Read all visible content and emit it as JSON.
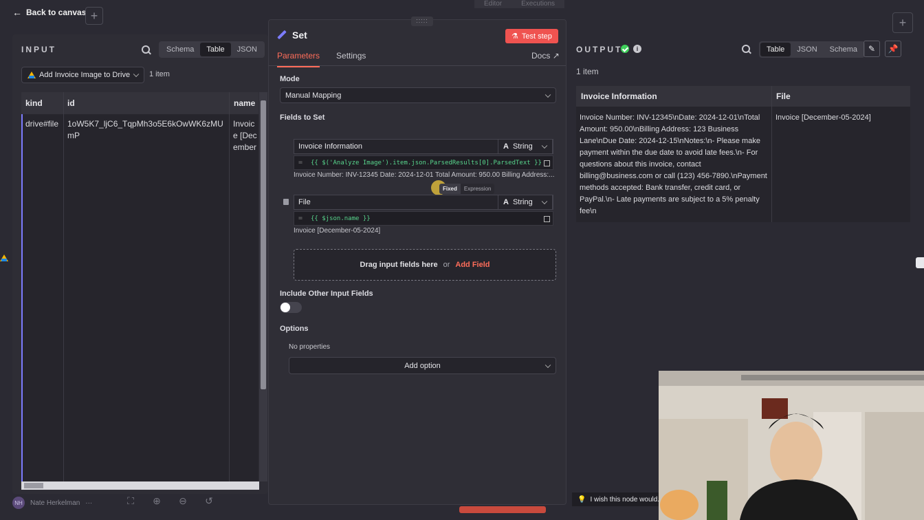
{
  "topbar": {
    "back_label": "Back to canvas",
    "tabs": [
      "Editor",
      "Executions"
    ]
  },
  "input": {
    "title": "INPUT",
    "view_modes": [
      "Schema",
      "Table",
      "JSON"
    ],
    "active_view": "Table",
    "node_select": "Add Invoice Image to Drive",
    "items_count": "1 item",
    "columns": [
      "kind",
      "id",
      "name"
    ],
    "row": {
      "kind": "drive#file",
      "id": "1oW5K7_ljC6_TqpMh3o5E6kOwWK6zMUmP",
      "name": "Invoice [December-05-2024]"
    }
  },
  "node": {
    "title": "Set",
    "test_button": "Test step",
    "tabs": [
      "Parameters",
      "Settings"
    ],
    "docs_label": "Docs",
    "mode_label": "Mode",
    "mode_value": "Manual Mapping",
    "fields_label": "Fields to Set",
    "fields": [
      {
        "name": "Invoice Information",
        "type": "String",
        "expression": "{{ $('Analyze Image').item.json.ParsedResults[0].ParsedText }}",
        "preview": "Invoice Number: INV-12345 Date: 2024-12-01 Total Amount: 950.00 Billing Address:..."
      },
      {
        "name": "File",
        "type": "String",
        "expression": "{{ $json.name }}",
        "preview": "Invoice [December-05-2024]"
      }
    ],
    "toggle_fixed": "Fixed",
    "toggle_expression": "Expression",
    "drop_text": "Drag input fields here",
    "drop_or": "or",
    "add_field": "Add Field",
    "include_label": "Include Other Input Fields",
    "include_value": false,
    "options_label": "Options",
    "no_properties": "No properties",
    "add_option": "Add option"
  },
  "output": {
    "title": "OUTPUT",
    "view_modes": [
      "Table",
      "JSON",
      "Schema"
    ],
    "active_view": "Table",
    "items_count": "1 item",
    "columns": [
      "Invoice Information",
      "File"
    ],
    "row": {
      "info": "Invoice Number: INV-12345\\nDate: 2024-12-01\\nTotal Amount: 950.00\\nBilling Address: 123 Business Lane\\nDue Date: 2024-12-15\\nNotes:\\n- Please make payment within the due date to avoid late fees.\\n- For questions about this invoice, contact billing@business.com or call (123) 456-7890.\\nPayment methods accepted: Bank transfer, credit card, or PayPal.\\n- Late payments are subject to a 5% penalty fee\\n",
      "file": "Invoice [December-05-2024]"
    }
  },
  "bottom": {
    "user_initials": "NH",
    "user_name": "Nate Herkelman",
    "wish_text": "I wish this node would..."
  },
  "colors": {
    "accent": "#ff6d5a",
    "success": "#3ecf5a",
    "background": "#2b2a33",
    "test_button": "#ef5350"
  }
}
